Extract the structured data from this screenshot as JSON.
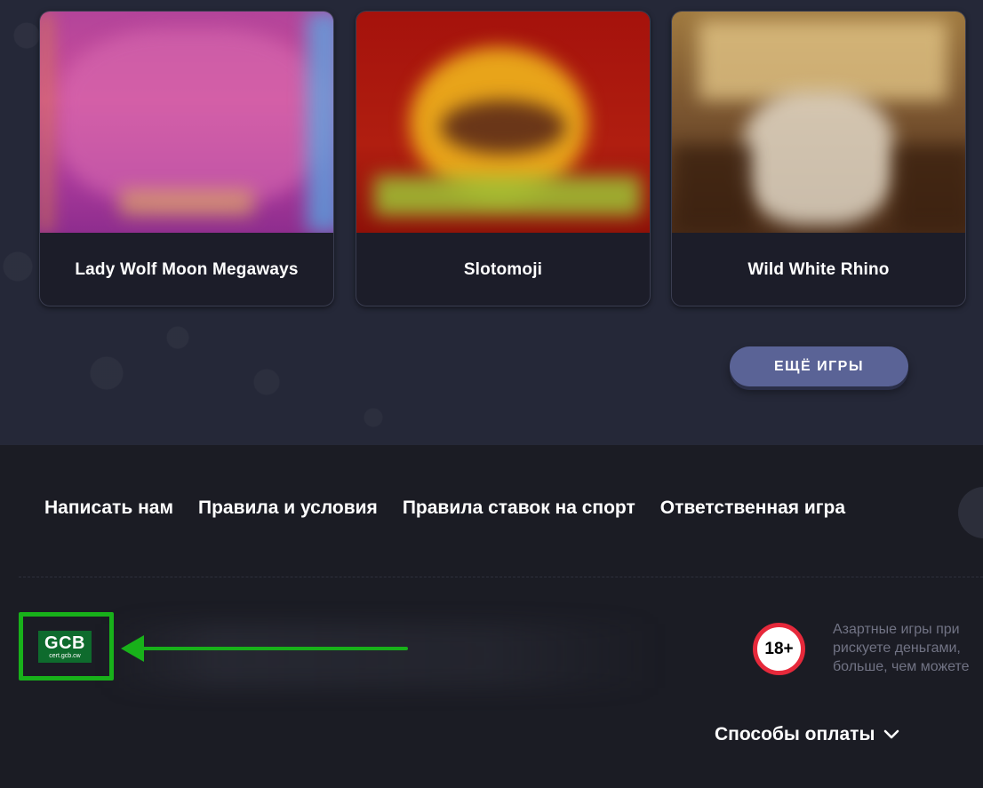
{
  "games": [
    {
      "title": "Lady Wolf Moon Megaways"
    },
    {
      "title": "Slotomoji"
    },
    {
      "title": "Wild White Rhino"
    }
  ],
  "more_button": "ЕЩЁ ИГРЫ",
  "footer": {
    "links": [
      "Написать нам",
      "Правила и условия",
      "Правила ставок на спорт",
      "Ответственная игра"
    ],
    "gcb": {
      "brand": "GCB",
      "domain": "cert.gcb.cw"
    },
    "age": "18+",
    "disclaimer": [
      "Азартные игры при",
      "рискуете деньгами,",
      "больше, чем можете"
    ],
    "payments_label": "Способы оплаты"
  },
  "colors": {
    "annotation": "#18b11a",
    "age_ring": "#e6293b",
    "button": "#5a6396"
  }
}
